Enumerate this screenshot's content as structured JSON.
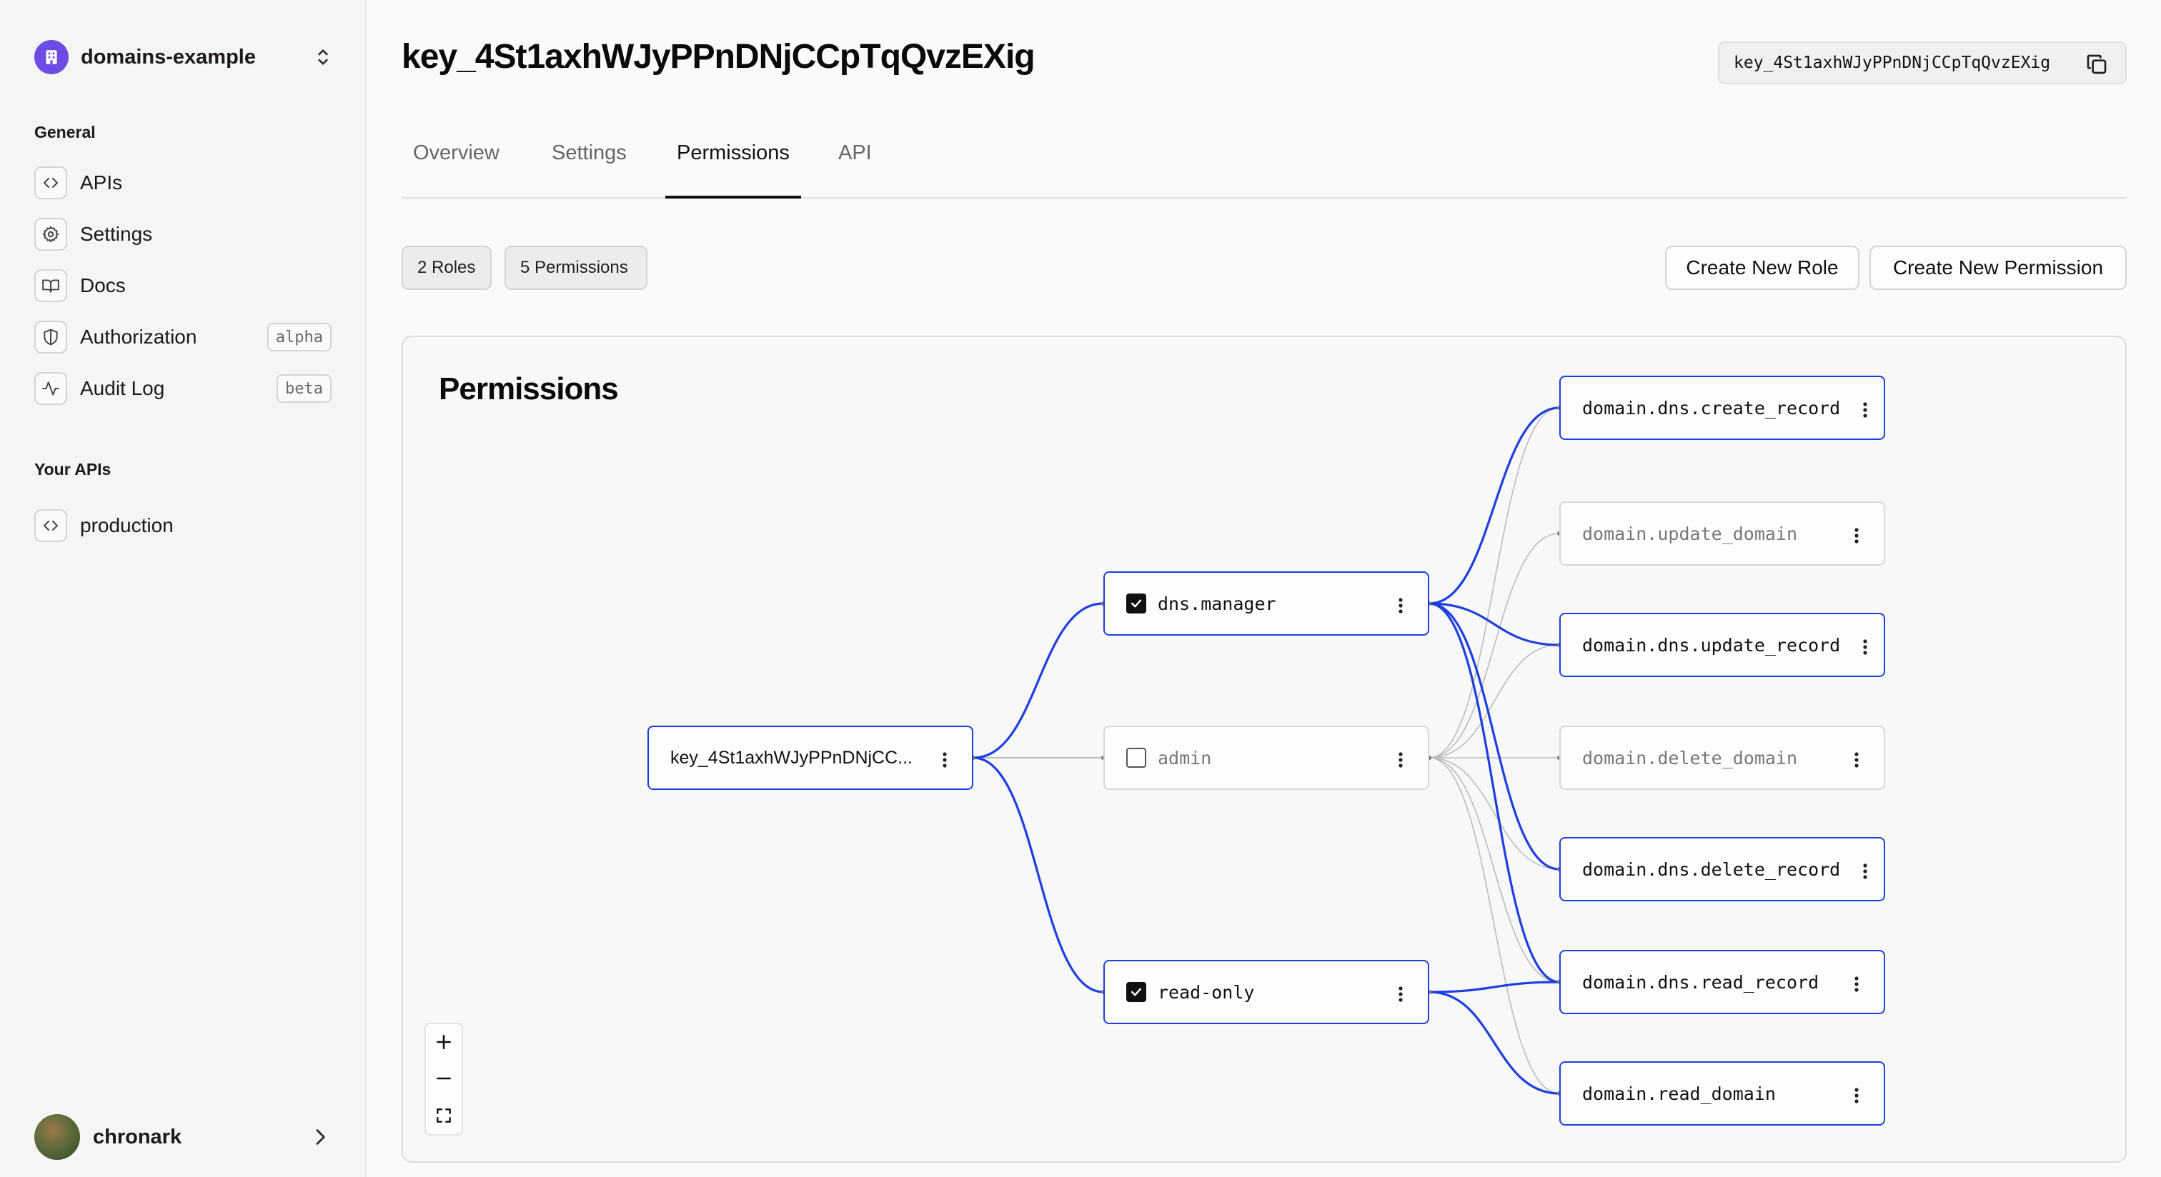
{
  "workspace": {
    "name": "domains-example"
  },
  "sidebar": {
    "general_title": "General",
    "items": [
      {
        "label": "APIs",
        "icon": "code-icon"
      },
      {
        "label": "Settings",
        "icon": "gear-icon"
      },
      {
        "label": "Docs",
        "icon": "book-icon"
      },
      {
        "label": "Authorization",
        "icon": "shield-icon",
        "badge": "alpha"
      },
      {
        "label": "Audit Log",
        "icon": "activity-icon",
        "badge": "beta"
      }
    ],
    "apis_title": "Your APIs",
    "apis": [
      {
        "label": "production",
        "icon": "code-icon"
      }
    ]
  },
  "user": {
    "name": "chronark"
  },
  "header": {
    "title": "key_4St1axhWJyPPnDNjCCpTqQvzEXig",
    "key_id": "key_4St1axhWJyPPnDNjCCpTqQvzEXig"
  },
  "tabs": [
    {
      "label": "Overview",
      "active": false
    },
    {
      "label": "Settings",
      "active": false
    },
    {
      "label": "Permissions",
      "active": true
    },
    {
      "label": "API",
      "active": false
    }
  ],
  "stats": {
    "roles": "2 Roles",
    "permissions": "5 Permissions"
  },
  "actions": {
    "create_role": "Create New Role",
    "create_permission": "Create New Permission"
  },
  "graph": {
    "title": "Permissions",
    "key_node": "key_4St1axhWJyPPnDNjCC...",
    "roles": [
      {
        "name": "dns.manager",
        "checked": true
      },
      {
        "name": "admin",
        "checked": false
      },
      {
        "name": "read-only",
        "checked": true
      }
    ],
    "permissions": [
      {
        "name": "domain.dns.create_record",
        "granted": true
      },
      {
        "name": "domain.update_domain",
        "granted": false
      },
      {
        "name": "domain.dns.update_record",
        "granted": true
      },
      {
        "name": "domain.delete_domain",
        "granted": false
      },
      {
        "name": "domain.dns.delete_record",
        "granted": true
      },
      {
        "name": "domain.dns.read_record",
        "granted": true
      },
      {
        "name": "domain.read_domain",
        "granted": true
      }
    ],
    "colors": {
      "active": "#1d3fe0",
      "inactive": "#bcbcbc"
    }
  }
}
